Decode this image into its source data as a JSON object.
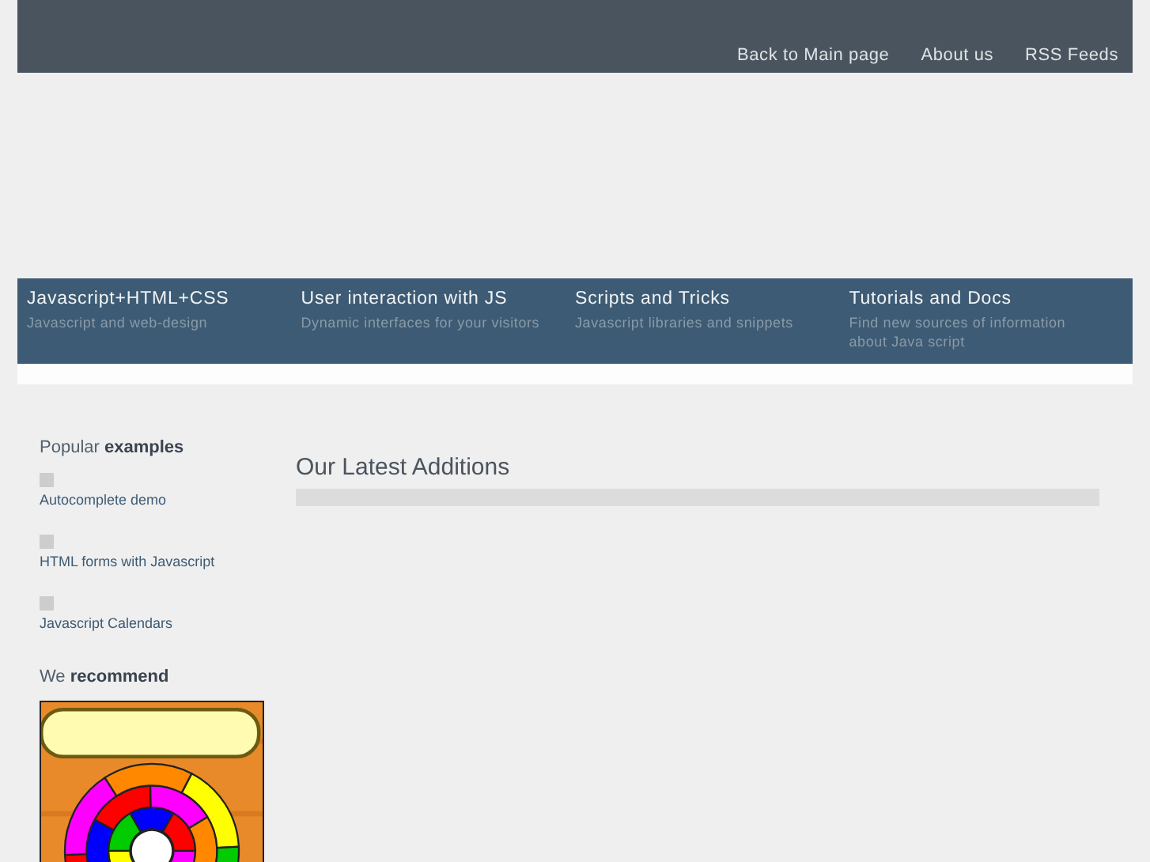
{
  "top_links": [
    "Back to Main page",
    "About us",
    "RSS Feeds"
  ],
  "nav": [
    {
      "title": "Javascript+HTML+CSS",
      "subtitle": "Javascript and web-design"
    },
    {
      "title": "User interaction with JS",
      "subtitle": "Dynamic interfaces for your visitors"
    },
    {
      "title": "Scripts and Tricks",
      "subtitle": "Javascript libraries and snippets"
    },
    {
      "title": "Tutorials and Docs",
      "subtitle": "Find new sources of information about Java script"
    }
  ],
  "sidebar": {
    "popular_heading": "Popular **examples**",
    "popular": [
      "Autocomplete demo",
      "HTML forms with Javascript",
      "Javascript Calendars"
    ],
    "recommend_heading": "We **recommend**",
    "banner": {
      "kind": "picture"
    }
  },
  "main": {
    "heading": "Our Latest Additions"
  }
}
